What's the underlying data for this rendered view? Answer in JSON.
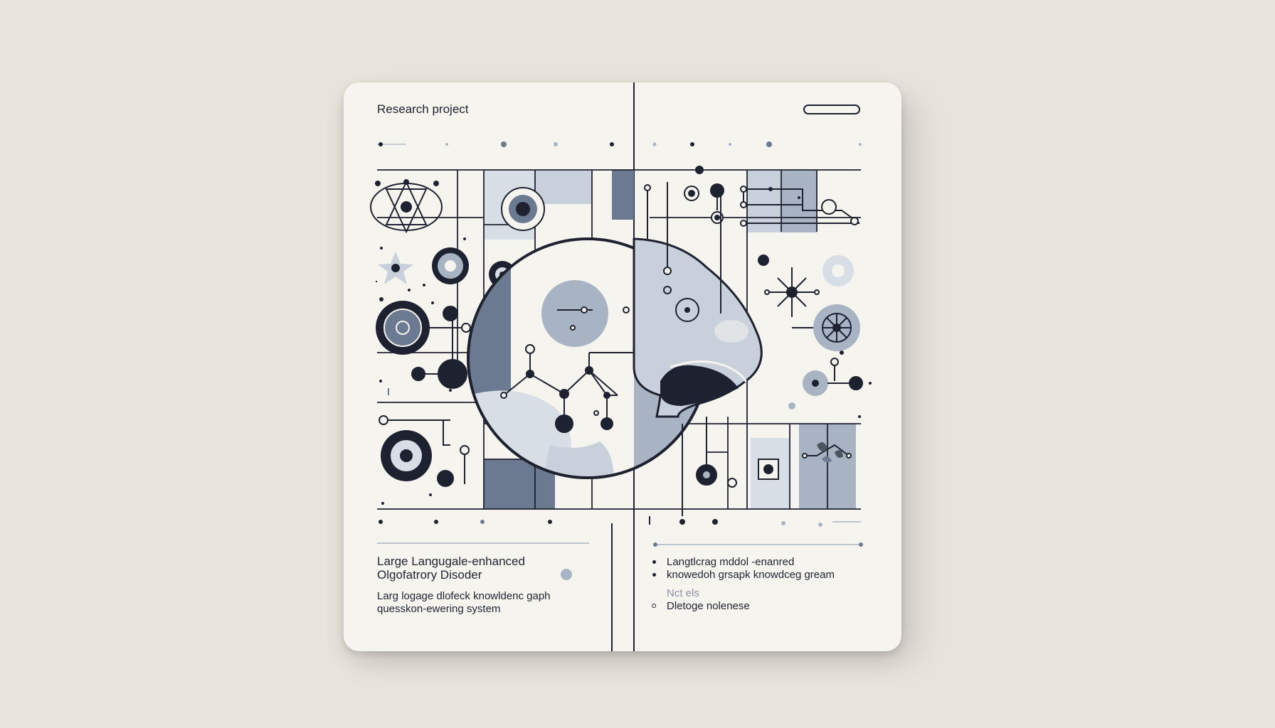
{
  "card": {
    "title": "Research project"
  },
  "left_text": {
    "heading_line1": "Large Langugale-enhanced",
    "heading_line2": "Olgofatrory Disoder",
    "sub_line1": "Larg logage dlofeck knowldenc gaph",
    "sub_line2": "quesskon-ewering system"
  },
  "right_text": {
    "items": [
      {
        "line1": "Langtlcrag mddol -enanred",
        "line2": "knowedoh grsapk knowdceg gream"
      },
      {
        "line1": "Nct els",
        "line2": "Dletoge nolenese"
      }
    ]
  },
  "colors": {
    "ink": "#1e2230",
    "slate": "#6b7a90",
    "light_slate": "#a8b4c4",
    "pale": "#d8dee6",
    "card": "#f6f4ee",
    "background": "#e8e4dc"
  },
  "icons": [
    "atom-icon",
    "flower-icon",
    "gear-icon",
    "target-icon",
    "magnifier-icon",
    "nose-icon",
    "network-icon",
    "leaf-icon"
  ]
}
